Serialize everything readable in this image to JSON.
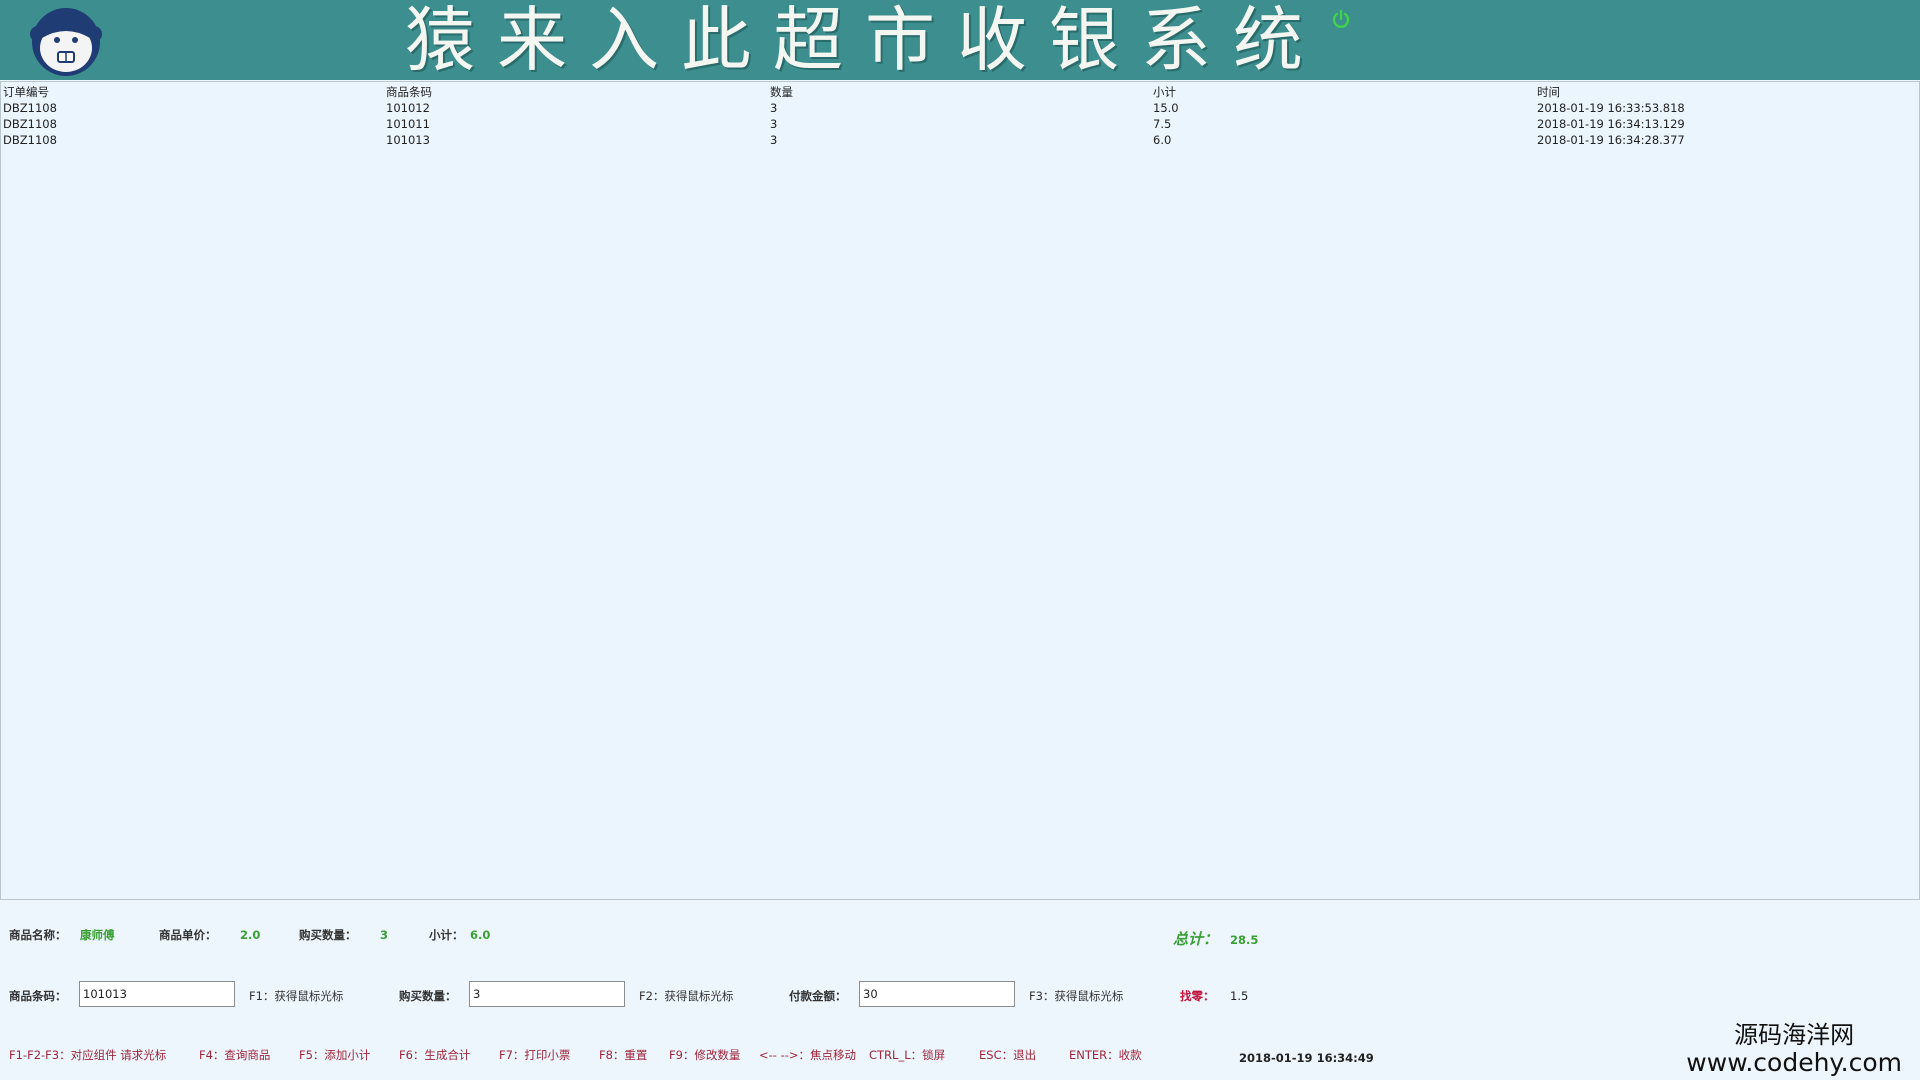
{
  "header": {
    "title": "猿来入此超市收银系统",
    "bg_color": "#3d8e8e",
    "logo_icon": "monkey-logo-icon",
    "power_icon": "power-icon"
  },
  "table": {
    "columns": [
      "订单编号",
      "商品条码",
      "数量",
      "小计",
      "时间"
    ],
    "rows": [
      [
        "DBZ1108",
        "101012",
        "3",
        "15.0",
        "2018-01-19 16:33:53.818"
      ],
      [
        "DBZ1108",
        "101011",
        "3",
        "7.5",
        "2018-01-19 16:34:13.129"
      ],
      [
        "DBZ1108",
        "101013",
        "3",
        "6.0",
        "2018-01-19 16:34:28.377"
      ]
    ]
  },
  "info": {
    "product_name_label": "商品名称：",
    "product_name_value": "康师傅",
    "unit_price_label": "商品单价：",
    "unit_price_value": "2.0",
    "buy_qty_label": "购买数量：",
    "buy_qty_value": "3",
    "subtotal_label": "小计：",
    "subtotal_value": "6.0",
    "total_label": "总计：",
    "total_value": "28.5"
  },
  "inputs": {
    "barcode_label": "商品条码：",
    "barcode_value": "101013",
    "barcode_hint": "F1：获得鼠标光标",
    "qty_label": "购买数量：",
    "qty_value": "3",
    "qty_hint": "F2：获得鼠标光标",
    "pay_label": "付款金额：",
    "pay_value": "30",
    "pay_hint": "F3：获得鼠标光标",
    "change_label": "找零：",
    "change_value": "1.5"
  },
  "shortcuts": [
    "F1-F2-F3：对应组件 请求光标",
    "F4：查询商品",
    "F5：添加小计",
    "F6：生成合计",
    "F7：打印小票",
    "F8：重置",
    "F9：修改数量",
    "<-- -->：焦点移动",
    "CTRL_L：锁屏",
    "ESC：退出",
    "ENTER：收款"
  ],
  "clock": "2018-01-19 16:34:49",
  "watermark": {
    "line1": "源码海洋网",
    "line2": "www.codehy.com"
  }
}
